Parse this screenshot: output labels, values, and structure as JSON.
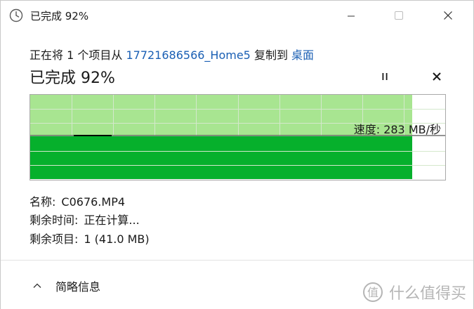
{
  "window": {
    "title": "已完成 92%"
  },
  "copy": {
    "prefix": "正在将 1 个项目从 ",
    "source": "17721686566_Home5",
    "middle": " 复制到 ",
    "destination": "桌面"
  },
  "progress": {
    "title": "已完成 92%",
    "percent_complete": 92,
    "speed_label": "速度: 283 MB/秒"
  },
  "details": {
    "name_label": "名称:",
    "name_value": "C0676.MP4",
    "time_label": "剩余时间:",
    "time_value": "正在计算...",
    "items_label": "剩余项目:",
    "items_value": "1 (41.0 MB)"
  },
  "footer": {
    "collapse_label": "简略信息"
  },
  "watermark": {
    "text": "什么值得买"
  },
  "colors": {
    "progress_fill": "#06b02c",
    "progress_light": "#a8e591",
    "link": "#1a5fb4"
  },
  "icons": {
    "title": "clock-icon",
    "minimize": "minimize-icon",
    "maximize": "maximize-icon",
    "close": "close-icon",
    "pause": "pause-icon",
    "cancel": "cancel-icon",
    "collapse": "chevron-up-icon"
  }
}
